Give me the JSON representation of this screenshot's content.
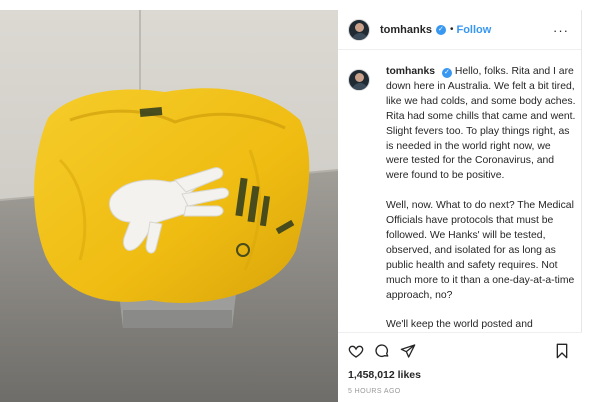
{
  "post": {
    "username": "tomhanks",
    "verified_icon": "verified-badge-icon",
    "follow_label": "Follow",
    "separator": "•",
    "more_label": "···",
    "caption_username": "tomhanks",
    "caption_paragraphs": [
      "Hello, folks. Rita and I are down here in Australia. We felt a bit tired, like we had colds, and some body aches. Rita had some chills that came and went. Slight fevers too. To play things right, as is needed in the world right now, we were tested for the Coronavirus, and were found to be positive.",
      "Well, now. What to do next? The Medical Officials have protocols that must be followed. We Hanks' will be tested, observed, and isolated for as long as public health and safety requires. Not much more to it than a one-day-at-a-time approach, no?",
      "We'll keep the world posted and updated."
    ],
    "likes": "1,458,012 likes",
    "timestamp": "5 HOURS AGO",
    "icons": {
      "like": "heart-icon",
      "comment": "comment-icon",
      "share": "share-icon",
      "save": "bookmark-icon"
    }
  },
  "photo": {
    "description_icon": "photo",
    "colors": {
      "wall": "#d6d3cd",
      "floor": "#8e8b86",
      "bag": "#f2c21b",
      "bin": "#9a9a98",
      "glove": "#f4f2ee"
    }
  }
}
